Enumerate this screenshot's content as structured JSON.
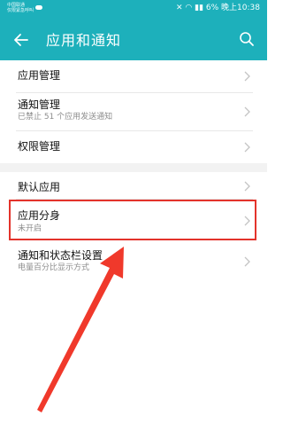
{
  "status_bar": {
    "carrier_line1": "中国联通",
    "carrier_line2": "仅限紧急呼叫",
    "right_text": "6% 晚上10:38"
  },
  "header": {
    "title": "应用和通知",
    "back_icon": "back-arrow-icon",
    "search_icon": "search-icon",
    "background": "#1db0bb"
  },
  "items": [
    {
      "label": "应用管理",
      "sub": ""
    },
    {
      "label": "通知管理",
      "sub": "已禁止 51 个应用发送通知"
    },
    {
      "label": "权限管理",
      "sub": ""
    },
    {
      "label": "默认应用",
      "sub": ""
    },
    {
      "label": "应用分身",
      "sub": "未开启"
    },
    {
      "label": "通知和状态栏设置",
      "sub": "电量百分比显示方式"
    }
  ],
  "colors": {
    "accent": "#1db0bb",
    "highlight": "#e3332b",
    "arrow": "#f0392b"
  }
}
